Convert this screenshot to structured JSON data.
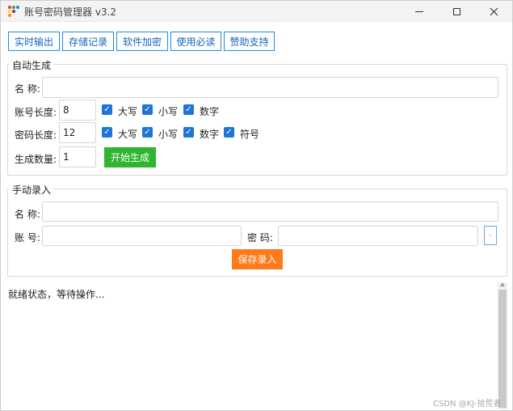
{
  "window": {
    "title": "账号密码管理器 v3.2"
  },
  "toolbar": {
    "buttons": [
      "实时输出",
      "存储记录",
      "软件加密",
      "使用必读",
      "赞助支持"
    ]
  },
  "auto_generate": {
    "group_title": "自动生成",
    "name_label": "名 称:",
    "name_value": "",
    "account_length_label": "账号长度:",
    "account_length_value": "8",
    "account_options": [
      {
        "label": "大写",
        "checked": true
      },
      {
        "label": "小写",
        "checked": true
      },
      {
        "label": "数字",
        "checked": true
      }
    ],
    "password_length_label": "密码长度:",
    "password_length_value": "12",
    "password_options": [
      {
        "label": "大写",
        "checked": true
      },
      {
        "label": "小写",
        "checked": true
      },
      {
        "label": "数字",
        "checked": true
      },
      {
        "label": "符号",
        "checked": true
      }
    ],
    "count_label": "生成数量:",
    "count_value": "1",
    "start_button": "开始生成",
    "start_color": "#2fb52f"
  },
  "manual_entry": {
    "group_title": "手动录入",
    "name_label": "名 称:",
    "name_value": "",
    "account_label": "账 号:",
    "account_value": "",
    "password_label": "密 码:",
    "password_value": "",
    "save_button": "保存录入",
    "save_color": "#ff7a1a"
  },
  "log": {
    "status_text": "就绪状态，等待操作..."
  },
  "watermark": "CSDN @KJ-拾荒者",
  "icons": {
    "app": "app-dots-icon",
    "minimize": "minimize-icon",
    "maximize": "maximize-icon",
    "close": "close-icon",
    "password_toggle": "eye-icon",
    "check": "check-icon"
  },
  "colors": {
    "accent_blue": "#1e88e5",
    "checkbox_blue": "#1e74d8"
  }
}
